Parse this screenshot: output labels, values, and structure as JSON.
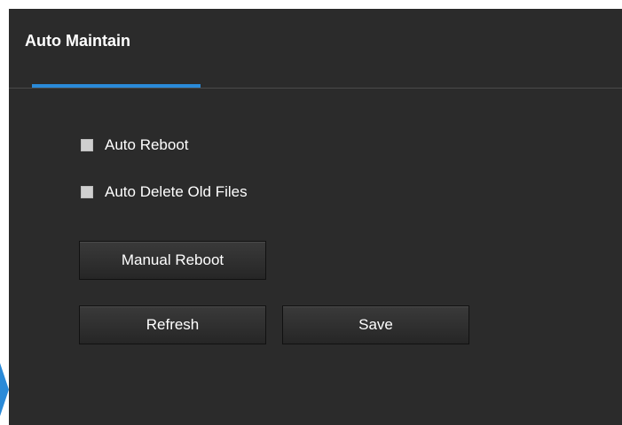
{
  "header": {
    "title": "Auto Maintain"
  },
  "options": {
    "auto_reboot_label": "Auto Reboot",
    "auto_reboot_checked": false,
    "auto_delete_label": "Auto Delete Old Files",
    "auto_delete_checked": false
  },
  "buttons": {
    "manual_reboot_label": "Manual Reboot",
    "refresh_label": "Refresh",
    "save_label": "Save"
  },
  "colors": {
    "panel_bg": "#2b2b2b",
    "accent": "#2a8ad8",
    "text": "#ffffff",
    "checkbox": "#cfcfcf"
  }
}
